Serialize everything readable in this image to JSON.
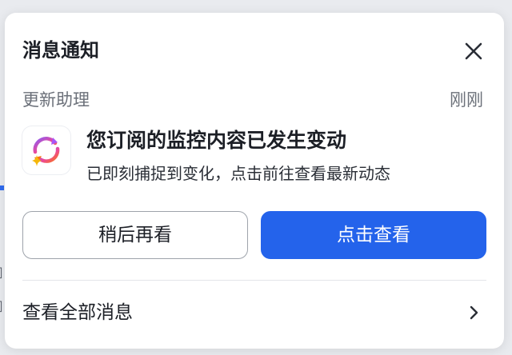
{
  "notification": {
    "title": "消息通知",
    "source": "更新助理",
    "time": "刚刚",
    "headline": "您订阅的监控内容已发生变动",
    "body": "已即刻捕捉到变化，点击前往查看最新动态",
    "later_button": "稍后再看",
    "view_button": "点击查看",
    "view_all": "查看全部消息"
  },
  "icons": {
    "close": "close-icon",
    "app": "sync-sparkle-icon",
    "chevron": "chevron-right-icon"
  },
  "colors": {
    "primary": "#2463eb",
    "title_text": "#1c1f26",
    "muted_text": "#6b7079",
    "icon_gradient_start": "#8b5cf6",
    "icon_gradient_end": "#f97316",
    "sparkle": "#f5b70a"
  }
}
